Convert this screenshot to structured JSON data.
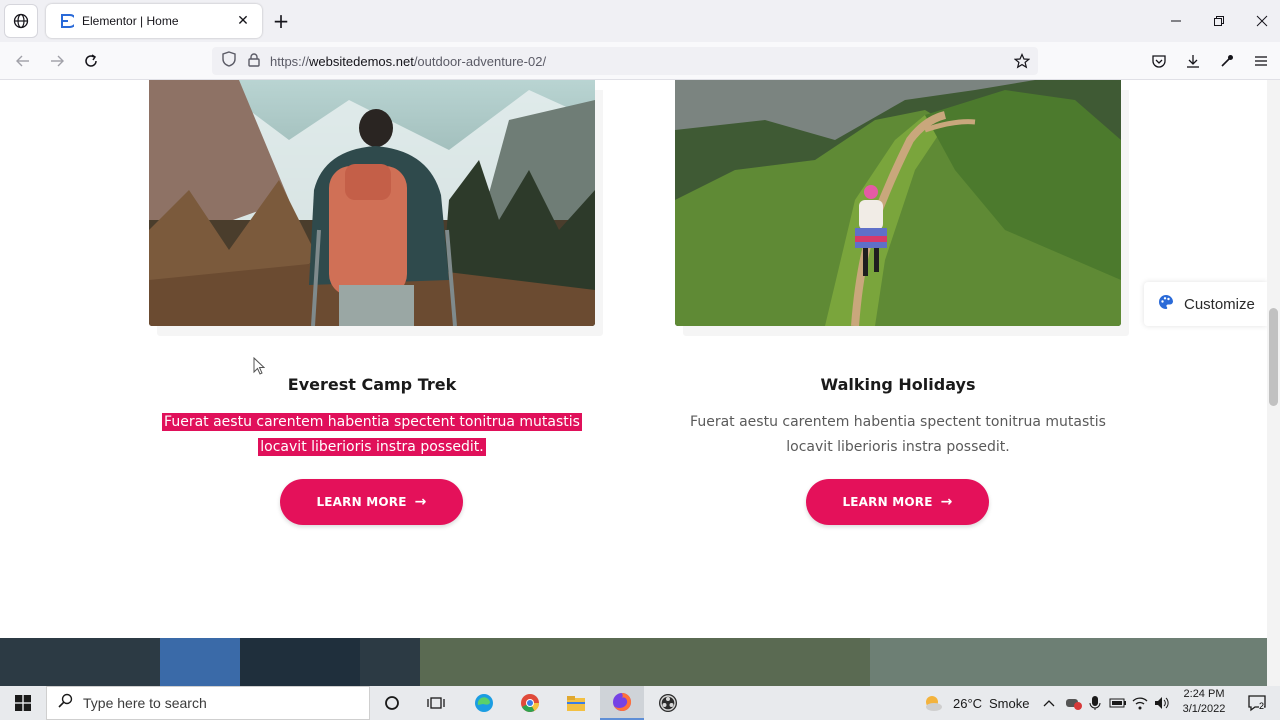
{
  "browser": {
    "tab_title": "Elementor | Home",
    "tab_close": "✕",
    "new_tab": "+",
    "url_scheme": "https://",
    "url_host": "websitedemos.net",
    "url_path": "/outdoor-adventure-02/"
  },
  "cards": [
    {
      "title": "Everest Camp Trek",
      "text_line1": "Fuerat aestu carentem habentia spectent tonitrua mutastis",
      "text_line2": "locavit liberioris instra possedit.",
      "button": "LEARN MORE",
      "arrow": "→"
    },
    {
      "title": "Walking Holidays",
      "text_line1": "Fuerat aestu carentem habentia spectent tonitrua mutastis",
      "text_line2": "locavit liberioris instra possedit.",
      "button": "LEARN MORE",
      "arrow": "→"
    }
  ],
  "customize": {
    "label": "Customize"
  },
  "taskbar": {
    "search_placeholder": "Type here to search",
    "weather_temp": "26°C",
    "weather_desc": "Smoke",
    "time": "2:24 PM",
    "date": "3/1/2022",
    "notifications": "2"
  },
  "colors": {
    "accent": "#e4115a",
    "highlight": "#e0105a"
  }
}
